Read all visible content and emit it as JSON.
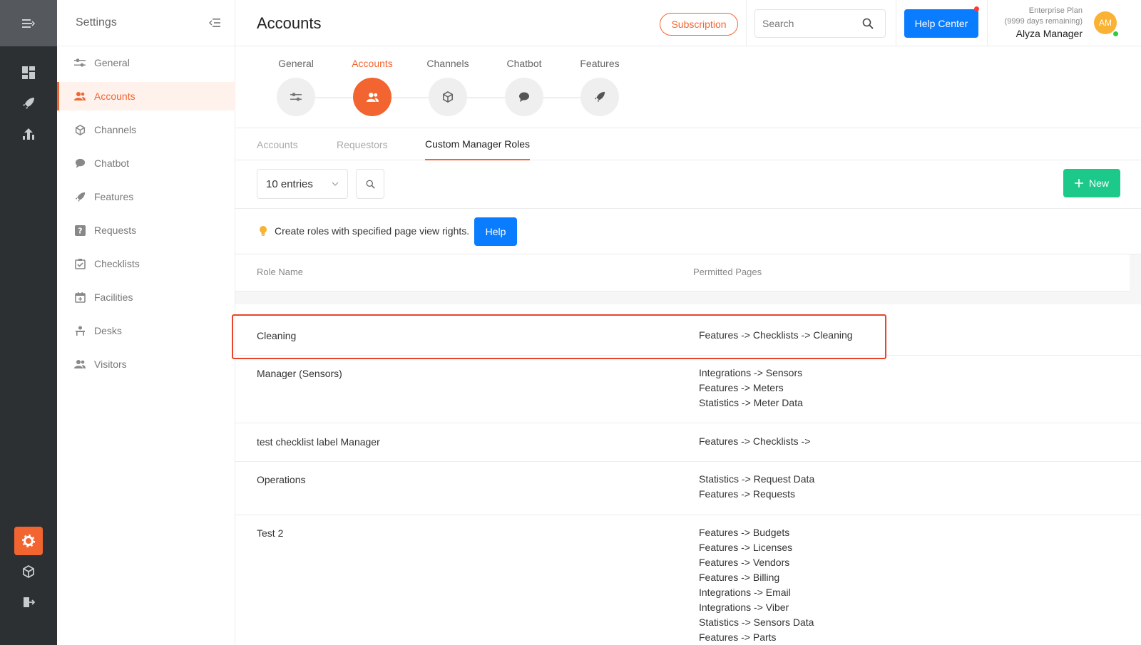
{
  "app": {
    "settings_title": "Settings",
    "page_title": "Accounts"
  },
  "header": {
    "subscription_label": "Subscription",
    "search_placeholder": "Search",
    "help_center_label": "Help Center",
    "plan": "Enterprise Plan",
    "days_remaining": "(9999 days remaining)",
    "user_name": "Alyza Manager",
    "avatar_initials": "AM"
  },
  "sidebar": {
    "items": [
      {
        "label": "General",
        "icon": "sliders-icon"
      },
      {
        "label": "Accounts",
        "icon": "users-icon",
        "active": true
      },
      {
        "label": "Channels",
        "icon": "cube-icon"
      },
      {
        "label": "Chatbot",
        "icon": "chat-icon"
      },
      {
        "label": "Features",
        "icon": "rocket-icon"
      },
      {
        "label": "Requests",
        "icon": "question-icon"
      },
      {
        "label": "Checklists",
        "icon": "checklist-icon"
      },
      {
        "label": "Facilities",
        "icon": "calendar-icon"
      },
      {
        "label": "Desks",
        "icon": "desk-icon"
      },
      {
        "label": "Visitors",
        "icon": "visitors-icon"
      }
    ]
  },
  "stepper": {
    "steps": [
      {
        "label": "General",
        "icon": "sliders-icon"
      },
      {
        "label": "Accounts",
        "icon": "users-icon",
        "active": true
      },
      {
        "label": "Channels",
        "icon": "cube-icon"
      },
      {
        "label": "Chatbot",
        "icon": "chat-icon"
      },
      {
        "label": "Features",
        "icon": "rocket-icon"
      }
    ]
  },
  "subtabs": [
    {
      "label": "Accounts"
    },
    {
      "label": "Requestors"
    },
    {
      "label": "Custom Manager Roles",
      "active": true
    }
  ],
  "toolbar": {
    "entries_label": "10 entries",
    "new_label": "New"
  },
  "info": {
    "text": "Create roles with specified page view rights.",
    "help_label": "Help"
  },
  "table": {
    "columns": [
      "Role Name",
      "Permitted Pages"
    ],
    "rows": [
      {
        "name": "Cleaning",
        "pages": [
          "Features -> Checklists -> Cleaning"
        ]
      },
      {
        "name": "Manager (Sensors)",
        "pages": [
          "Integrations -> Sensors",
          "Features -> Meters",
          "Statistics -> Meter Data"
        ]
      },
      {
        "name": "test checklist label Manager",
        "pages": [
          "Features -> Checklists ->"
        ]
      },
      {
        "name": "Operations",
        "pages": [
          "Statistics -> Request Data",
          "Features -> Requests"
        ]
      },
      {
        "name": "Test 2",
        "pages": [
          "Features -> Budgets",
          "Features -> Licenses",
          "Features -> Vendors",
          "Features -> Billing",
          "Integrations -> Email",
          "Integrations -> Viber",
          "Statistics -> Sensors Data",
          "Features -> Parts"
        ]
      }
    ]
  },
  "colors": {
    "accent": "#f26531",
    "primary_blue": "#0a7cff",
    "new_green": "#1cc98a",
    "rail": "#2d3033"
  }
}
